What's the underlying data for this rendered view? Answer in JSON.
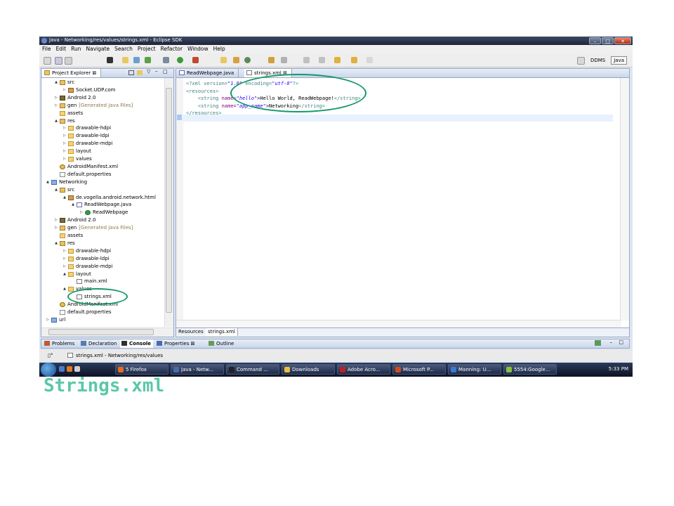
{
  "window": {
    "title": "Java - Networking/res/values/strings.xml - Eclipse SDK",
    "min": "–",
    "max": "□",
    "close": "✕"
  },
  "menu": [
    "File",
    "Edit",
    "Run",
    "Navigate",
    "Search",
    "Project",
    "Refactor",
    "Window",
    "Help"
  ],
  "perspectives": [
    {
      "label": "DDMS",
      "active": false
    },
    {
      "label": "Java",
      "active": true
    }
  ],
  "project_explorer": {
    "title": "Project Explorer",
    "tree": [
      {
        "label": "src",
        "depth": 1,
        "tw": "▲",
        "icon": "srcf"
      },
      {
        "label": "Socket.UDP.com",
        "depth": 2,
        "tw": "▷",
        "icon": "pkg"
      },
      {
        "label": "Android 2.0",
        "depth": 1,
        "tw": "▷",
        "icon": "lib"
      },
      {
        "label": "gen",
        "extra": "[Generated Java Files]",
        "depth": 1,
        "tw": "▷",
        "icon": "srcf"
      },
      {
        "label": "assets",
        "depth": 1,
        "tw": "",
        "icon": "folder"
      },
      {
        "label": "res",
        "depth": 1,
        "tw": "▲",
        "icon": "srcf"
      },
      {
        "label": "drawable-hdpi",
        "depth": 2,
        "tw": "▷",
        "icon": "folder"
      },
      {
        "label": "drawable-ldpi",
        "depth": 2,
        "tw": "▷",
        "icon": "folder"
      },
      {
        "label": "drawable-mdpi",
        "depth": 2,
        "tw": "▷",
        "icon": "folder"
      },
      {
        "label": "layout",
        "depth": 2,
        "tw": "▷",
        "icon": "folder"
      },
      {
        "label": "values",
        "depth": 2,
        "tw": "▷",
        "icon": "folder"
      },
      {
        "label": "AndroidManifest.xml",
        "depth": 1,
        "tw": "",
        "icon": "man"
      },
      {
        "label": "default.properties",
        "depth": 1,
        "tw": "",
        "icon": "file"
      },
      {
        "label": "Networking",
        "depth": 0,
        "tw": "▲",
        "icon": "proj"
      },
      {
        "label": "src",
        "depth": 1,
        "tw": "▲",
        "icon": "srcf"
      },
      {
        "label": "de.vogella.android.network.html",
        "depth": 2,
        "tw": "▲",
        "icon": "pkg"
      },
      {
        "label": "ReadWebpage.java",
        "depth": 3,
        "tw": "▲",
        "icon": "java"
      },
      {
        "label": "ReadWebpage",
        "depth": 4,
        "tw": "▷",
        "icon": "cls"
      },
      {
        "label": "Android 2.0",
        "depth": 1,
        "tw": "▷",
        "icon": "lib"
      },
      {
        "label": "gen",
        "extra": "[Generated Java Files]",
        "depth": 1,
        "tw": "▷",
        "icon": "srcf"
      },
      {
        "label": "assets",
        "depth": 1,
        "tw": "",
        "icon": "folder"
      },
      {
        "label": "res",
        "depth": 1,
        "tw": "▲",
        "icon": "srcf"
      },
      {
        "label": "drawable-hdpi",
        "depth": 2,
        "tw": "▷",
        "icon": "folder"
      },
      {
        "label": "drawable-ldpi",
        "depth": 2,
        "tw": "▷",
        "icon": "folder"
      },
      {
        "label": "drawable-mdpi",
        "depth": 2,
        "tw": "▷",
        "icon": "folder"
      },
      {
        "label": "layout",
        "depth": 2,
        "tw": "▲",
        "icon": "folder"
      },
      {
        "label": "main.xml",
        "depth": 3,
        "tw": "",
        "icon": "xml"
      },
      {
        "label": "values",
        "depth": 2,
        "tw": "▲",
        "icon": "folder"
      },
      {
        "label": "strings.xml",
        "depth": 3,
        "tw": "",
        "icon": "xml"
      },
      {
        "label": "AndroidManifest.xml",
        "depth": 1,
        "tw": "",
        "icon": "man"
      },
      {
        "label": "default.properties",
        "depth": 1,
        "tw": "",
        "icon": "file"
      },
      {
        "label": "url",
        "depth": 0,
        "tw": "▷",
        "icon": "proj"
      }
    ]
  },
  "editor": {
    "tabs": [
      {
        "label": "ReadWebpage.java",
        "active": false
      },
      {
        "label": "strings.xml",
        "active": true
      }
    ],
    "bottom_tabs": [
      {
        "label": "Resources",
        "active": false
      },
      {
        "label": "strings.xml",
        "active": true
      }
    ]
  },
  "xml_lines": [
    [
      {
        "t": "<?xml version=",
        "c": "k"
      },
      {
        "t": "\"1.0\"",
        "c": "s"
      },
      {
        "t": " encoding=",
        "c": "k"
      },
      {
        "t": "\"utf-8\"",
        "c": "s"
      },
      {
        "t": "?>",
        "c": "k"
      }
    ],
    [
      {
        "t": "<resources>",
        "c": "k"
      }
    ],
    [
      {
        "t": "    <string ",
        "c": "k"
      },
      {
        "t": "name=",
        "c": "a"
      },
      {
        "t": "\"hello\"",
        "c": "s"
      },
      {
        "t": ">Hello World, ReadWebpage!",
        "c": ""
      },
      {
        "t": "</string>",
        "c": "k"
      }
    ],
    [
      {
        "t": "    <string ",
        "c": "k"
      },
      {
        "t": "name=",
        "c": "a"
      },
      {
        "t": "\"app_name\"",
        "c": "s"
      },
      {
        "t": ">Networking",
        "c": ""
      },
      {
        "t": "</string>",
        "c": "k"
      }
    ],
    [
      {
        "t": "</resources>",
        "c": "k"
      }
    ]
  ],
  "bottom_views": [
    {
      "label": "Problems",
      "active": false
    },
    {
      "label": "Declaration",
      "active": false
    },
    {
      "label": "Console",
      "active": true
    },
    {
      "label": "Properties",
      "active": false
    },
    {
      "label": "Outline",
      "active": false
    }
  ],
  "status": {
    "text": "strings.xml - Networking/res/values"
  },
  "taskbar": {
    "items": [
      {
        "label": "5 Firefox",
        "color": "#e86a20"
      },
      {
        "label": "Java - Netw...",
        "color": "#4a6ab0"
      },
      {
        "label": "Command ...",
        "color": "#222222"
      },
      {
        "label": "Downloads",
        "color": "#e8c040"
      },
      {
        "label": "Adobe Acro...",
        "color": "#c02020"
      },
      {
        "label": "Microsoft P...",
        "color": "#d04a20"
      },
      {
        "label": "Manning: U...",
        "color": "#3a7ad0"
      },
      {
        "label": "5554:Google...",
        "color": "#8ac040"
      }
    ],
    "clock": "5:33 PM"
  },
  "caption": "Strings.xml",
  "colors": {
    "accent": "#169a6a",
    "caption": "#5ac8a8"
  }
}
